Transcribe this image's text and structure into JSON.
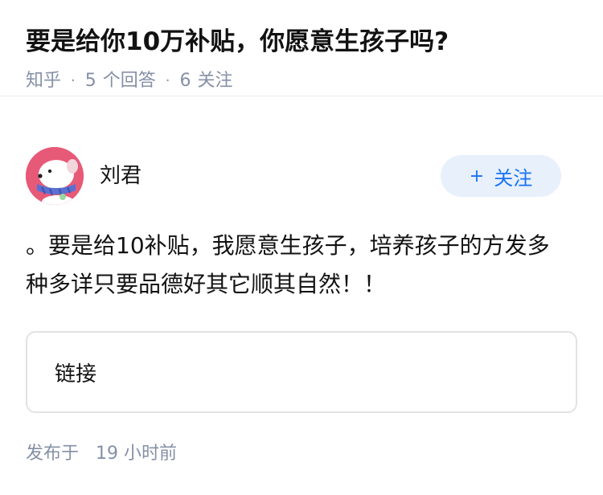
{
  "question": {
    "title": "要是给你10万补贴，你愿意生孩子吗?",
    "source": "知乎",
    "answers_count": "5",
    "answers_label": "个回答",
    "followers_count": "6",
    "followers_label": "关注"
  },
  "answer": {
    "author_name": "刘君",
    "avatar_icon": "cartoon-dog-avatar",
    "follow_label": "关注",
    "follow_icon": "plus-icon",
    "text": "。要是给10补贴，我愿意生孩子，培养孩子的方发多种多详只要品德好其它顺其自然！！",
    "link_label": "链接",
    "published_label": "发布于",
    "published_time": "19 小时前"
  },
  "colors": {
    "accent": "#1772f6",
    "follow_bg": "#e8f0fb",
    "meta_text": "#8590a6",
    "avatar_bg": "#e65a78"
  }
}
